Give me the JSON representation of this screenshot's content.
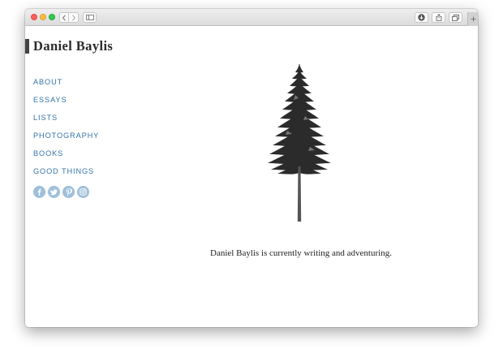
{
  "browser": {
    "icons": {
      "back": "chevron-left-icon",
      "forward": "chevron-right-icon",
      "sidebar": "sidebar-icon",
      "download": "download-icon",
      "share": "share-icon",
      "tabs": "tabs-icon",
      "new_tab": "plus-icon"
    }
  },
  "site": {
    "title": "Daniel Baylis",
    "accent_color": "#444444",
    "link_color": "#3273a8"
  },
  "nav": {
    "items": [
      {
        "label": "ABOUT"
      },
      {
        "label": "ESSAYS"
      },
      {
        "label": "LISTS"
      },
      {
        "label": "PHOTOGRAPHY"
      },
      {
        "label": "BOOKS"
      },
      {
        "label": "GOOD THINGS"
      }
    ]
  },
  "social": {
    "color": "#9fbfda",
    "icons": [
      "facebook-icon",
      "twitter-icon",
      "pinterest-icon",
      "instagram-icon"
    ]
  },
  "main": {
    "image": "pine-tree-illustration",
    "tagline": "Daniel Baylis is currently writing and adventuring."
  }
}
